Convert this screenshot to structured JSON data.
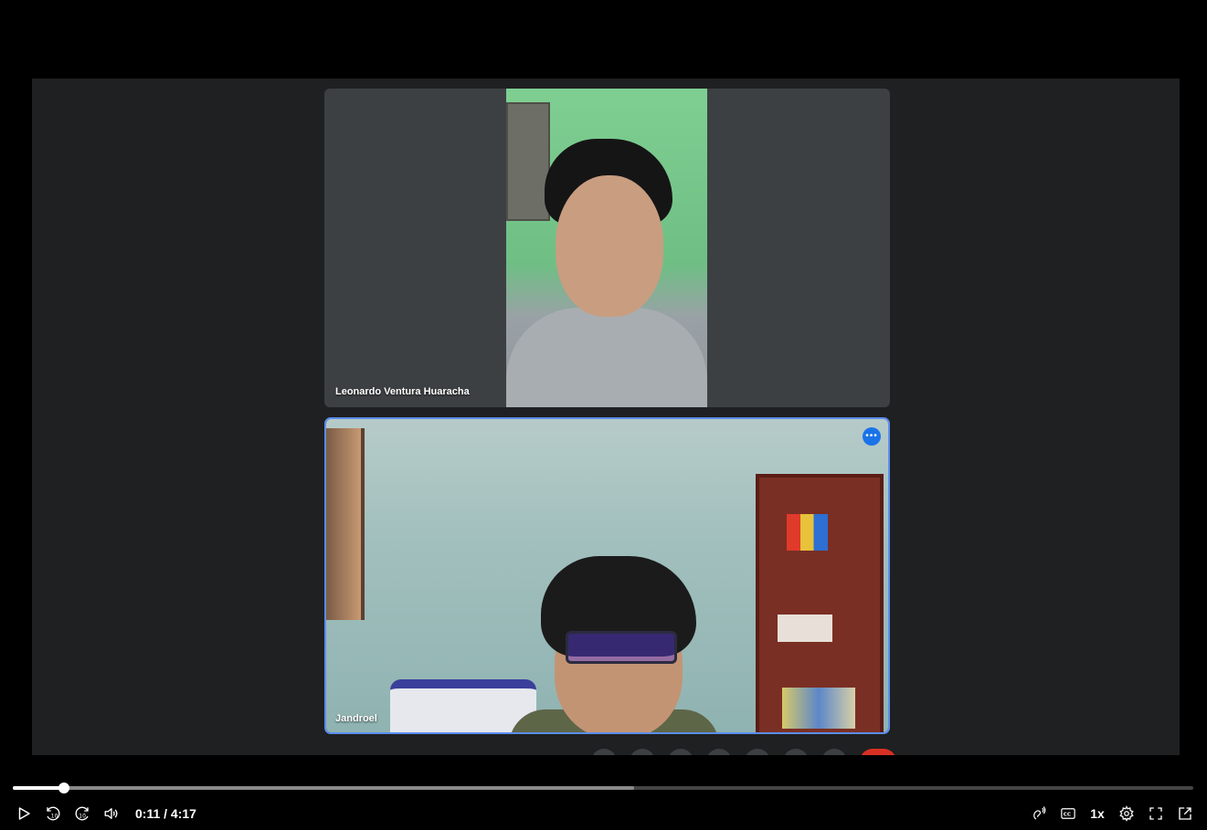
{
  "meeting": {
    "participants": [
      {
        "name": "Leonardo Ventura Huaracha"
      },
      {
        "name": "Jandroel"
      }
    ],
    "more_options_icon": "more-horizontal-icon"
  },
  "player": {
    "current_time": "0:11",
    "duration": "4:17",
    "time_display": "0:11 / 4:17",
    "played_fraction": 0.043,
    "buffered_fraction": 0.526,
    "playback_speed": "1x",
    "accent_color": "#ffffff",
    "icons": {
      "play": "play-icon",
      "rewind": "rewind-10-icon",
      "forward": "forward-10-icon",
      "volume": "volume-icon",
      "audio_description": "audio-description-icon",
      "captions": "closed-captions-icon",
      "settings": "gear-icon",
      "fullscreen": "fullscreen-icon",
      "popout": "popout-icon"
    }
  }
}
